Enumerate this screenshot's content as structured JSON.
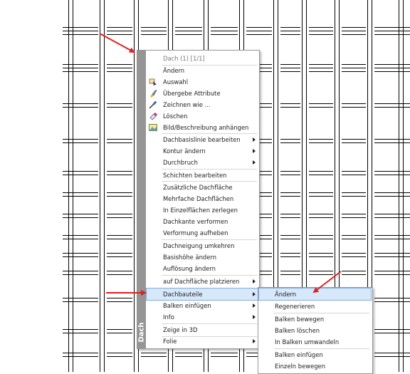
{
  "context_menu": {
    "header": "Dach (1) [1/1]",
    "side_label": "Dach",
    "items": [
      {
        "label": "Ändern",
        "icon": "none"
      },
      {
        "label": "Auswahl",
        "icon": "selection-icon"
      },
      {
        "label": "Übergebe Attribute",
        "icon": "brush-icon"
      },
      {
        "label": "Zeichnen wie ...",
        "icon": "pipette-icon"
      },
      {
        "label": "Löschen",
        "icon": "eraser-icon"
      },
      {
        "label": "Bild/Beschreibung anhängen",
        "icon": "image-icon"
      },
      {
        "label": "Dachbasislinie bearbeiten",
        "submenu": true
      },
      {
        "label": "Kontur ändern",
        "submenu": true
      },
      {
        "label": "Durchbruch",
        "submenu": true
      },
      {
        "label": "Schichten bearbeiten"
      },
      {
        "label": "Zusätzliche Dachfläche"
      },
      {
        "label": "Mehrfache Dachflächen"
      },
      {
        "label": "In Einzelflächen zerlegen"
      },
      {
        "label": "Dachkante verformen"
      },
      {
        "label": "Verformung aufheben"
      },
      {
        "label": "Dachneigung umkehren"
      },
      {
        "label": "Basishöhe ändern"
      },
      {
        "label": "Auflösung ändern"
      },
      {
        "label": "auf Dachfläche platzieren",
        "submenu": true
      },
      {
        "label": "Dachbauteile",
        "submenu": true,
        "highlighted": true
      },
      {
        "label": "Balken einfügen",
        "submenu": true
      },
      {
        "label": "Info",
        "submenu": true
      },
      {
        "label": "Zeige in 3D"
      },
      {
        "label": "Folie",
        "submenu": true
      }
    ]
  },
  "submenu": {
    "items": [
      {
        "label": "Ändern",
        "highlighted": true
      },
      {
        "label": "Regenerieren"
      },
      {
        "label": "Balken bewegen"
      },
      {
        "label": "Balken löschen"
      },
      {
        "label": "In Balken umwandeln"
      },
      {
        "label": "Balken einfügen"
      },
      {
        "label": "Einzeln bewegen"
      }
    ]
  },
  "colors": {
    "highlight": "#d6e8fa",
    "highlight_border": "#84acdd",
    "side_strip": "#959595",
    "annotation_arrow": "#e02020"
  }
}
